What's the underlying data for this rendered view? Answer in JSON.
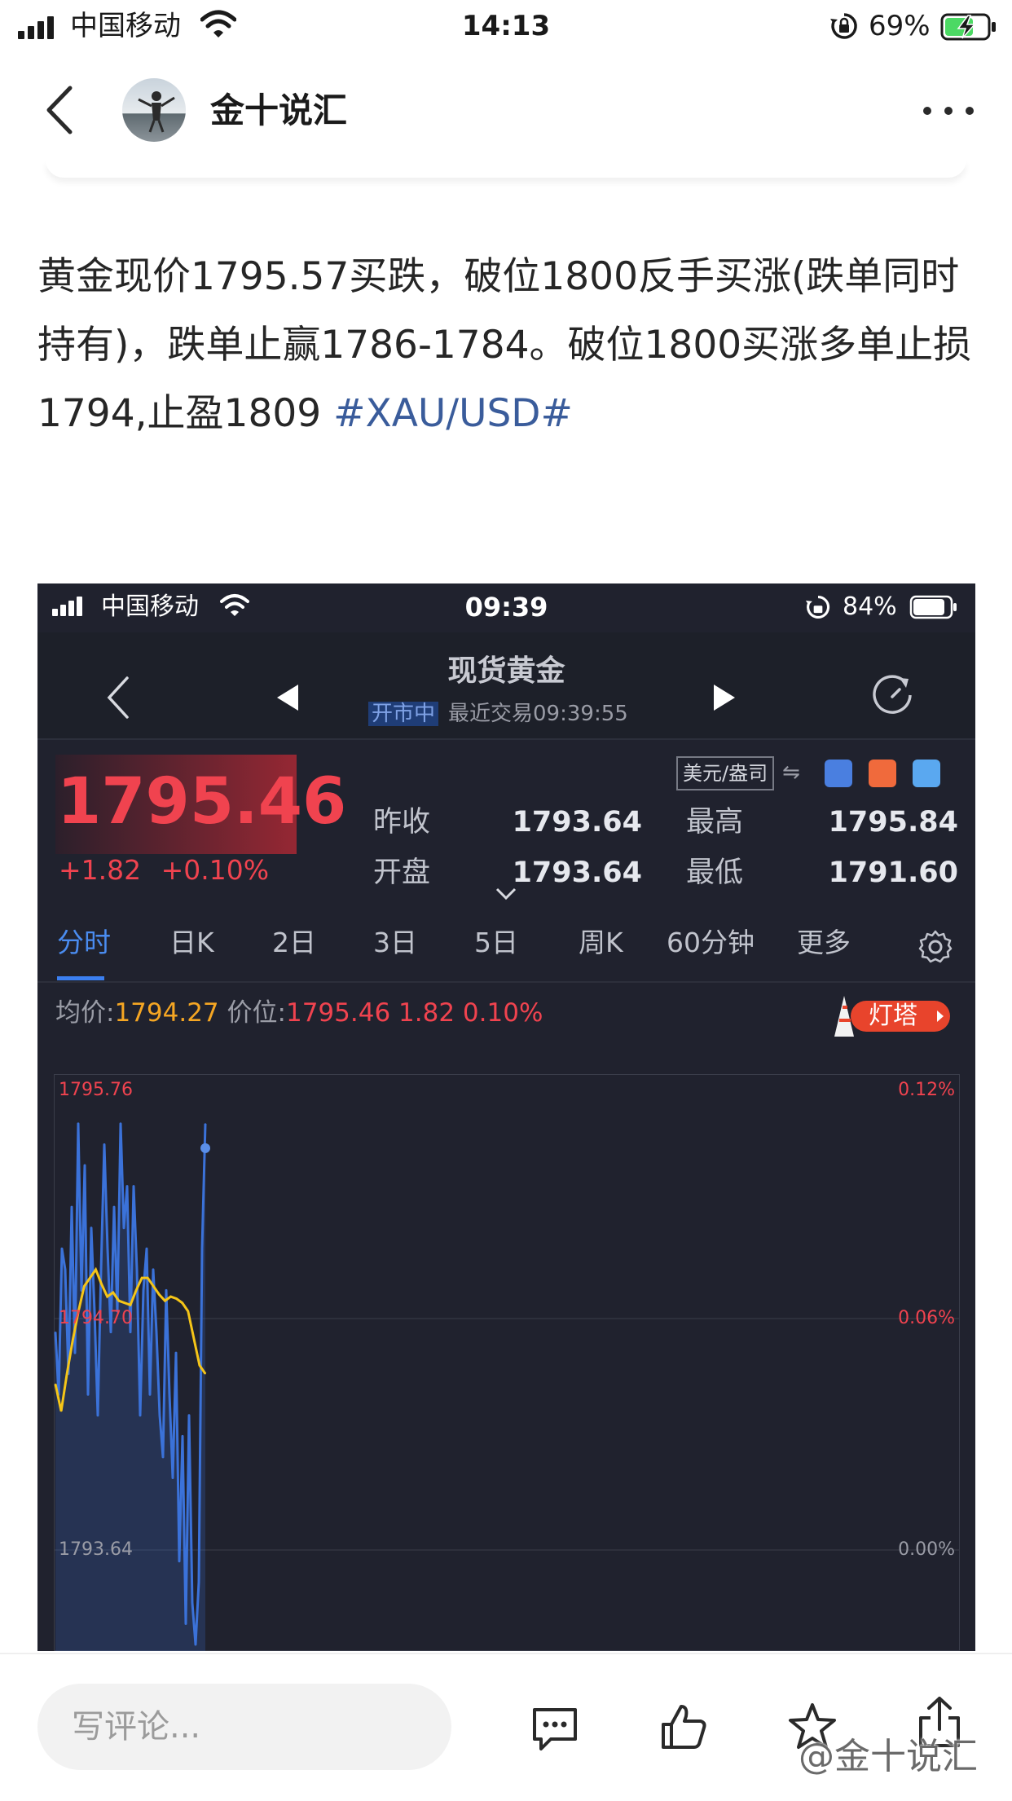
{
  "status_bar": {
    "carrier": "中国移动",
    "time": "14:13",
    "battery": "69%"
  },
  "nav": {
    "author": "金十说汇"
  },
  "post": {
    "text": "黄金现价1795.57买跌，破位1800反手买涨(跌单同时持有)，跌单止赢1786-1784。破位1800买涨多单止损1794,止盈1809 ",
    "hashtag": "#XAU/USD#"
  },
  "embedded_screenshot": {
    "status_bar": {
      "carrier": "中国移动",
      "time": "09:39",
      "battery": "84%"
    },
    "header": {
      "title": "现货黄金",
      "market_status": "开市中",
      "last_trade": "最近交易09:39:55"
    },
    "quote": {
      "price": "1795.46",
      "change": "+1.82",
      "change_pct": "+0.10%",
      "unit_selector": "美元/盎司",
      "prev_close_label": "昨收",
      "prev_close": "1793.64",
      "open_label": "开盘",
      "open": "1793.64",
      "high_label": "最高",
      "high": "1795.84",
      "low_label": "最低",
      "low": "1791.60"
    },
    "tabs": [
      "分时",
      "日K",
      "2日",
      "3日",
      "5日",
      "周K",
      "60分钟",
      "更多"
    ],
    "active_tab": "分时",
    "avg_row": {
      "avg_label": "均价:",
      "avg_value": "1794.27",
      "price_label": "价位:",
      "price_value": "1795.46",
      "change": "1.82",
      "change_pct": "0.10%"
    },
    "lighthouse_label": "灯塔",
    "colors": {
      "background": "#20222e",
      "up": "#f0434f",
      "price_line": "#3b72d9",
      "avg_line": "#f5c518",
      "accent": "#4a8cf0"
    }
  },
  "chart_data": {
    "type": "line",
    "title": "",
    "y_labels_left": [
      "1795.76",
      "1794.70",
      "1793.64"
    ],
    "y_labels_right": [
      "0.12%",
      "0.06%",
      "0.00%"
    ],
    "ylim": [
      1793.1,
      1795.76
    ],
    "series": [
      {
        "values": [
          1794.6,
          1794.3,
          1795.0,
          1794.9,
          1794.4,
          1795.2,
          1794.5,
          1795.6,
          1794.8,
          1795.4,
          1794.3,
          1795.1,
          1794.7,
          1794.2,
          1794.9,
          1795.5,
          1795.0,
          1794.6,
          1795.2,
          1794.7,
          1795.6,
          1795.1,
          1795.3,
          1794.6,
          1795.3,
          1794.9,
          1794.2,
          1794.8,
          1795.0,
          1794.3,
          1794.9,
          1794.6,
          1794.2,
          1794.0,
          1794.8,
          1794.3,
          1793.9,
          1794.5,
          1793.5,
          1794.1,
          1793.2,
          1794.2,
          1793.3,
          1793.1,
          1793.4,
          1795.0,
          1795.6
        ]
      },
      {
        "values": [
          1794.35,
          1794.22,
          1794.4,
          1794.56,
          1794.7,
          1794.82,
          1794.86,
          1794.9,
          1794.83,
          1794.77,
          1794.79,
          1794.75,
          1794.74,
          1794.73,
          1794.8,
          1794.86,
          1794.86,
          1794.82,
          1794.78,
          1794.75,
          1794.77,
          1794.76,
          1794.74,
          1794.7,
          1794.57,
          1794.44,
          1794.4
        ]
      }
    ]
  },
  "bottom_bar": {
    "comment_placeholder": "写评论...",
    "watermark": "@金十说汇"
  }
}
